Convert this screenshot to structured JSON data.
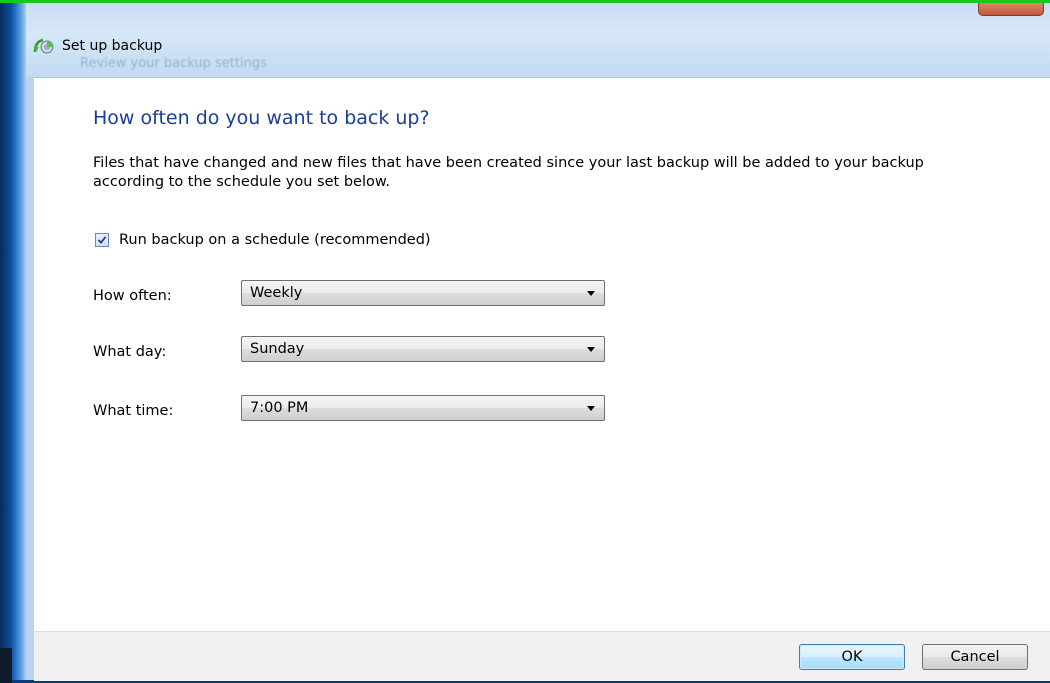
{
  "window": {
    "title": "Set up backup",
    "ghost_text": "Review your backup settings"
  },
  "page": {
    "heading": "How often do you want to back up?",
    "description": "Files that have changed and new files that have been created since your last backup will be added to your backup according to the schedule you set below."
  },
  "schedule": {
    "checkbox_label": "Run backup on a schedule (recommended)",
    "checked": true,
    "how_often": {
      "label": "How often:",
      "value": "Weekly"
    },
    "what_day": {
      "label": "What day:",
      "value": "Sunday"
    },
    "what_time": {
      "label": "What time:",
      "value": "7:00 PM"
    }
  },
  "buttons": {
    "ok": "OK",
    "cancel": "Cancel"
  },
  "icons": {
    "app": "backup-icon",
    "dropdown": "chevron-down-icon",
    "check": "checkmark-icon"
  },
  "colors": {
    "heading": "#1a3d9a",
    "ok_border": "#3c7fb1",
    "top_strip": "#18c81a"
  }
}
